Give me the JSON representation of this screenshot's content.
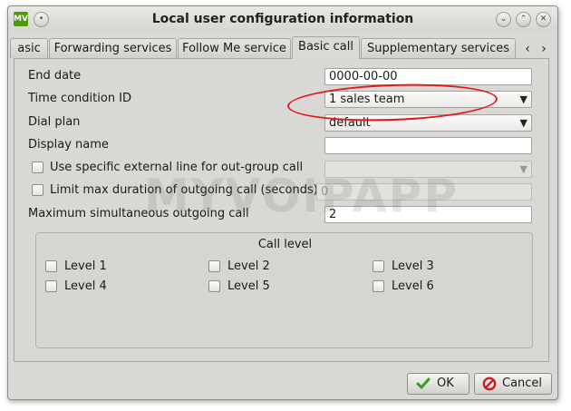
{
  "window": {
    "title": "Local user configuration information",
    "app_icon_text": "MV"
  },
  "tabs": [
    {
      "label": "asic"
    },
    {
      "label": "Forwarding services"
    },
    {
      "label": "Follow Me service"
    },
    {
      "label": "Basic call"
    },
    {
      "label": "Supplementary services"
    }
  ],
  "active_tab": "Basic call",
  "form": {
    "end_date_label": "End date",
    "end_date_value": "0000-00-00",
    "time_condition_label": "Time condition ID",
    "time_condition_value": "1 sales team",
    "dial_plan_label": "Dial plan",
    "dial_plan_value": "default",
    "display_name_label": "Display name",
    "display_name_value": "",
    "external_line_label": "Use specific external line for out-group call",
    "external_line_checked": false,
    "external_line_value": "",
    "max_duration_label": "Limit max duration of outgoing call (seconds)",
    "max_duration_checked": false,
    "max_duration_value": "0",
    "max_simultaneous_label": "Maximum simultaneous outgoing call",
    "max_simultaneous_value": "2"
  },
  "call_level": {
    "title": "Call level",
    "levels": [
      "Level 1",
      "Level 2",
      "Level 3",
      "Level 4",
      "Level 5",
      "Level 6"
    ]
  },
  "buttons": {
    "ok_label": "OK",
    "cancel_label": "Cancel"
  },
  "watermark": "MYVOIPAPP",
  "colors": {
    "annotation": "#e0181b",
    "ok_icon": "#3d9a1b",
    "cancel_icon": "#cc1f1f"
  }
}
